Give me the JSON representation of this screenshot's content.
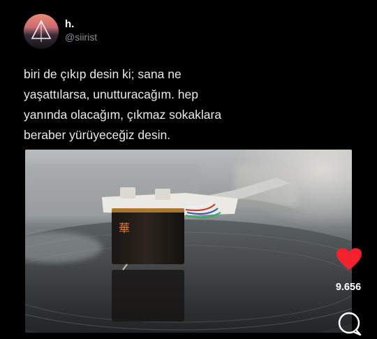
{
  "author": {
    "display_name": "h.",
    "handle": "@siirist"
  },
  "tweet": {
    "lines": [
      "biri de çıkıp desin ki; sana ne",
      "yaşattılarsa, unutturacağım. hep",
      "yanında olacağım, çıkmaz sokaklara",
      "beraber yürüyeceğiz desin."
    ]
  },
  "media": {
    "cartridge_glyph": "華"
  },
  "actions": {
    "like_count": "9.656",
    "like_icon": "heart-icon",
    "comment_icon": "comment-icon"
  },
  "colors": {
    "background": "#000000",
    "like": "#f4212e",
    "handle": "#8b8f94"
  }
}
